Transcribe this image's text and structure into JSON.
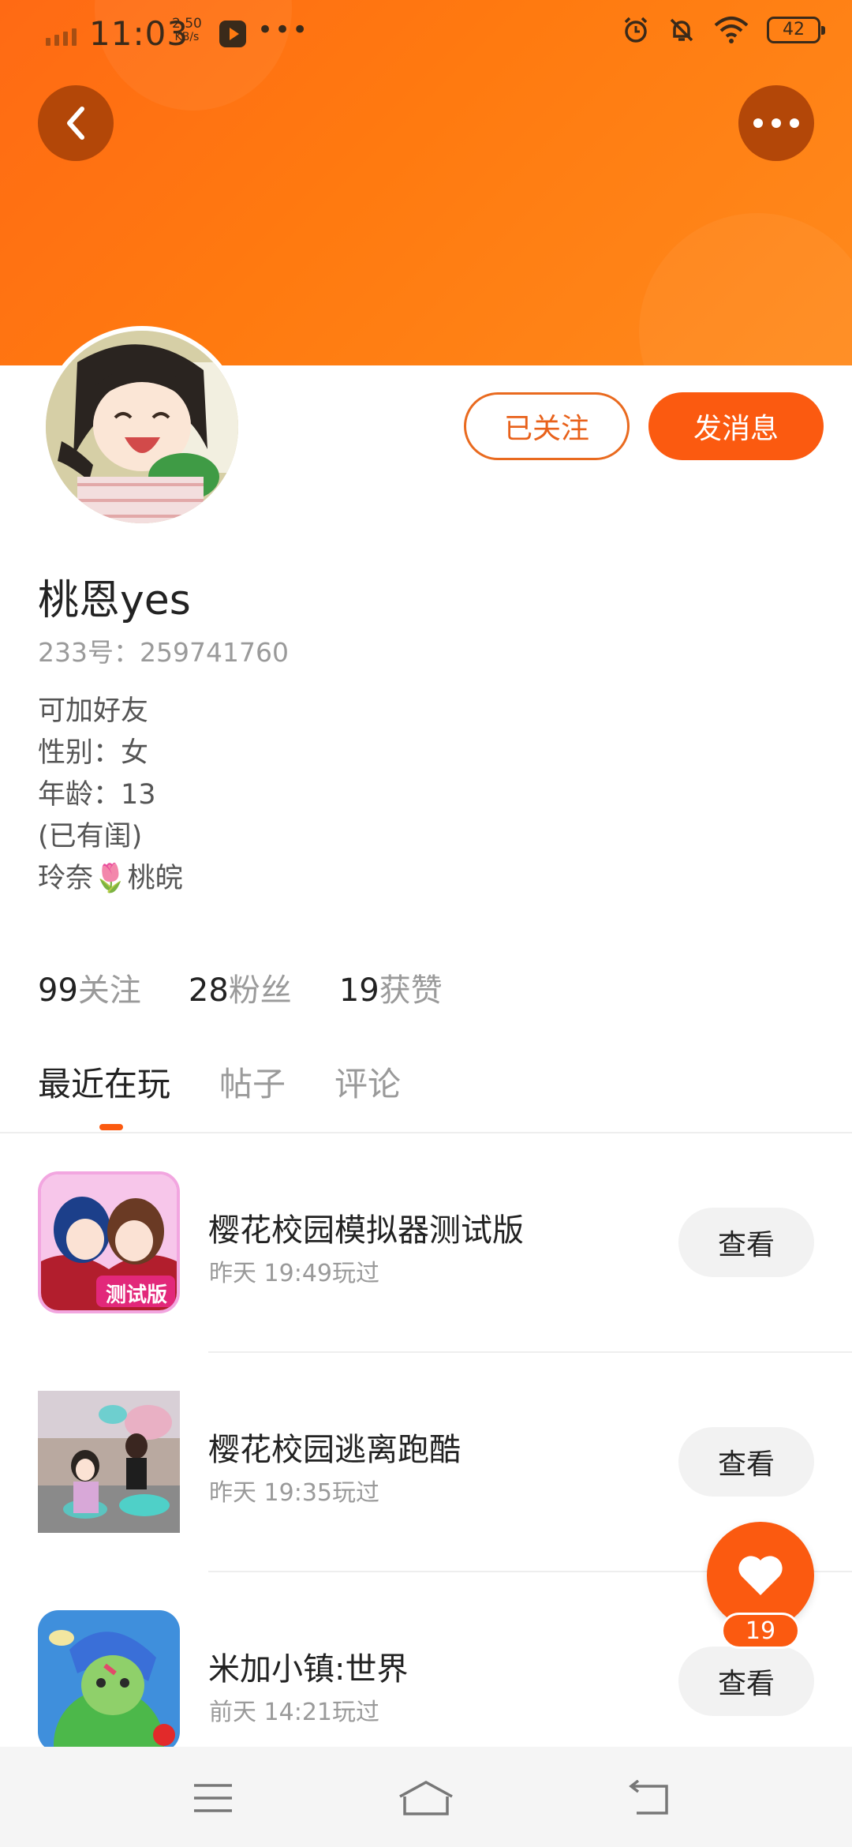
{
  "status_bar": {
    "time": "11:03",
    "net_speed_value": "2.50",
    "net_speed_unit": "KB/s",
    "more": "•••",
    "battery": "42"
  },
  "profile": {
    "followed_label": "已关注",
    "message_label": "发消息",
    "username": "桃恩yes",
    "uid": "233号：259741760",
    "bio_lines": [
      "可加好友",
      "性别：女",
      "年龄：13",
      "(已有闺)",
      "玲奈🌷桃皖"
    ]
  },
  "stats": {
    "following_count": "99",
    "following_label": "关注",
    "fans_count": "28",
    "fans_label": "粉丝",
    "likes_count": "19",
    "likes_label": "获赞"
  },
  "tabs": [
    {
      "label": "最近在玩",
      "active": true
    },
    {
      "label": "帖子",
      "active": false
    },
    {
      "label": "评论",
      "active": false
    }
  ],
  "games": [
    {
      "title": "樱花校园模拟器测试版",
      "played": "昨天 19:49玩过",
      "action": "查看",
      "icon_badge": "测试版"
    },
    {
      "title": "樱花校园逃离跑酷",
      "played": "昨天 19:35玩过",
      "action": "查看"
    },
    {
      "title": "米加小镇:世界",
      "played": "前天 14:21玩过",
      "action": "查看"
    }
  ],
  "like_fab": {
    "count": "19"
  },
  "colors": {
    "brand_orange": "#fb5a10",
    "banner_orange": "#ff7a10",
    "back_button": "#b34708"
  },
  "icons": {
    "back": "chevron-left-icon",
    "more": "more-horizontal-icon",
    "like": "heart-icon",
    "menu": "menu-icon",
    "home": "home-icon",
    "return": "back-arrow-icon"
  }
}
